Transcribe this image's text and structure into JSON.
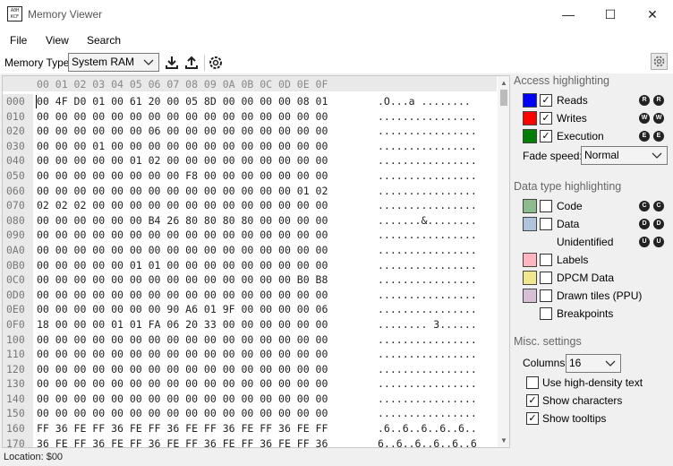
{
  "window": {
    "title": "Memory Viewer",
    "icon_text": "A0H\nKCF",
    "minimize": "—",
    "maximize": "☐",
    "close": "✕"
  },
  "menu": {
    "file": "File",
    "view": "View",
    "search": "Search"
  },
  "toolbar": {
    "memory_type_label": "Memory Type:",
    "memory_type_value": "System RAM"
  },
  "hex": {
    "column_header": "00 01 02 03 04 05 06 07 08 09 0A 0B 0C 0D 0E 0F",
    "rows": [
      {
        "addr": "000",
        "hex": "00 4F D0 01 00 61 20 00 05 8D 00 00 00 00 08 01",
        "chars": ".O...a ........"
      },
      {
        "addr": "010",
        "hex": "00 00 00 00 00 00 00 00 00 00 00 00 00 00 00 00",
        "chars": "................"
      },
      {
        "addr": "020",
        "hex": "00 00 00 00 00 00 06 00 00 00 00 00 00 00 00 00",
        "chars": "................"
      },
      {
        "addr": "030",
        "hex": "00 00 00 01 00 00 00 00 00 00 00 00 00 00 00 00",
        "chars": "................"
      },
      {
        "addr": "040",
        "hex": "00 00 00 00 00 01 02 00 00 00 00 00 00 00 00 00",
        "chars": "................"
      },
      {
        "addr": "050",
        "hex": "00 00 00 00 00 00 00 00 F8 00 00 00 00 00 00 00",
        "chars": "................"
      },
      {
        "addr": "060",
        "hex": "00 00 00 00 00 00 00 00 00 00 00 00 00 00 01 02",
        "chars": "................"
      },
      {
        "addr": "070",
        "hex": "02 02 02 00 00 00 00 00 00 00 00 00 00 00 00 00",
        "chars": "................"
      },
      {
        "addr": "080",
        "hex": "00 00 00 00 00 00 B4 26 80 80 80 80 00 00 00 00",
        "chars": ".......&........"
      },
      {
        "addr": "090",
        "hex": "00 00 00 00 00 00 00 00 00 00 00 00 00 00 00 00",
        "chars": "................"
      },
      {
        "addr": "0A0",
        "hex": "00 00 00 00 00 00 00 00 00 00 00 00 00 00 00 00",
        "chars": "................"
      },
      {
        "addr": "0B0",
        "hex": "00 00 00 00 00 01 01 00 00 00 00 00 00 00 00 00",
        "chars": "................"
      },
      {
        "addr": "0C0",
        "hex": "00 00 00 00 00 00 00 00 00 00 00 00 00 00 B0 B8",
        "chars": "................"
      },
      {
        "addr": "0D0",
        "hex": "00 00 00 00 00 00 00 00 00 00 00 00 00 00 00 00",
        "chars": "................"
      },
      {
        "addr": "0E0",
        "hex": "00 00 00 00 00 00 00 90 A6 01 9F 00 00 00 00 06",
        "chars": "................"
      },
      {
        "addr": "0F0",
        "hex": "18 00 00 00 01 01 FA 06 20 33 00 00 00 00 00 00",
        "chars": "........ 3......"
      },
      {
        "addr": "100",
        "hex": "00 00 00 00 00 00 00 00 00 00 00 00 00 00 00 00",
        "chars": "................"
      },
      {
        "addr": "110",
        "hex": "00 00 00 00 00 00 00 00 00 00 00 00 00 00 00 00",
        "chars": "................"
      },
      {
        "addr": "120",
        "hex": "00 00 00 00 00 00 00 00 00 00 00 00 00 00 00 00",
        "chars": "................"
      },
      {
        "addr": "130",
        "hex": "00 00 00 00 00 00 00 00 00 00 00 00 00 00 00 00",
        "chars": "................"
      },
      {
        "addr": "140",
        "hex": "00 00 00 00 00 00 00 00 00 00 00 00 00 00 00 00",
        "chars": "................"
      },
      {
        "addr": "150",
        "hex": "00 00 00 00 00 00 00 00 00 00 00 00 00 00 00 00",
        "chars": "................"
      },
      {
        "addr": "160",
        "hex": "FF 36 FE FF 36 FE FF 36 FE FF 36 FE FF 36 FE FF",
        "chars": ".6..6..6..6..6.."
      },
      {
        "addr": "170",
        "hex": "36 FE FF 36 FE FF 36 FE FF 36 FE FF 36 FE FF 36",
        "chars": "6..6..6..6..6..6"
      }
    ]
  },
  "status": {
    "location": "Location: $00"
  },
  "sidebar": {
    "access_title": "Access highlighting",
    "access": [
      {
        "label": "Reads",
        "checked": "✓",
        "color": "#0000ff",
        "key1": "R",
        "key2": "R"
      },
      {
        "label": "Writes",
        "checked": "✓",
        "color": "#ff0000",
        "key1": "W",
        "key2": "W"
      },
      {
        "label": "Execution",
        "checked": "✓",
        "color": "#008000",
        "key1": "E",
        "key2": "E"
      }
    ],
    "fade_label": "Fade speed:",
    "fade_value": "Normal",
    "datatype_title": "Data type highlighting",
    "datatypes": [
      {
        "label": "Code",
        "color": "#8fbc8f",
        "key1": "C",
        "key2": "C"
      },
      {
        "label": "Data",
        "color": "#b0c4de",
        "key1": "D",
        "key2": "D"
      },
      {
        "label": "Unidentified",
        "key1": "U",
        "key2": "U"
      },
      {
        "label": "Labels",
        "color": "#ffb6c1"
      },
      {
        "label": "DPCM Data",
        "color": "#f0e68c"
      },
      {
        "label": "Drawn tiles (PPU)",
        "color": "#d8bfd8"
      },
      {
        "label": "Breakpoints"
      }
    ],
    "misc_title": "Misc. settings",
    "columns_label": "Columns:",
    "columns_value": "16",
    "misc": [
      {
        "label": "Use high-density text",
        "checked": ""
      },
      {
        "label": "Show characters",
        "checked": "✓"
      },
      {
        "label": "Show tooltips",
        "checked": "✓"
      }
    ]
  }
}
